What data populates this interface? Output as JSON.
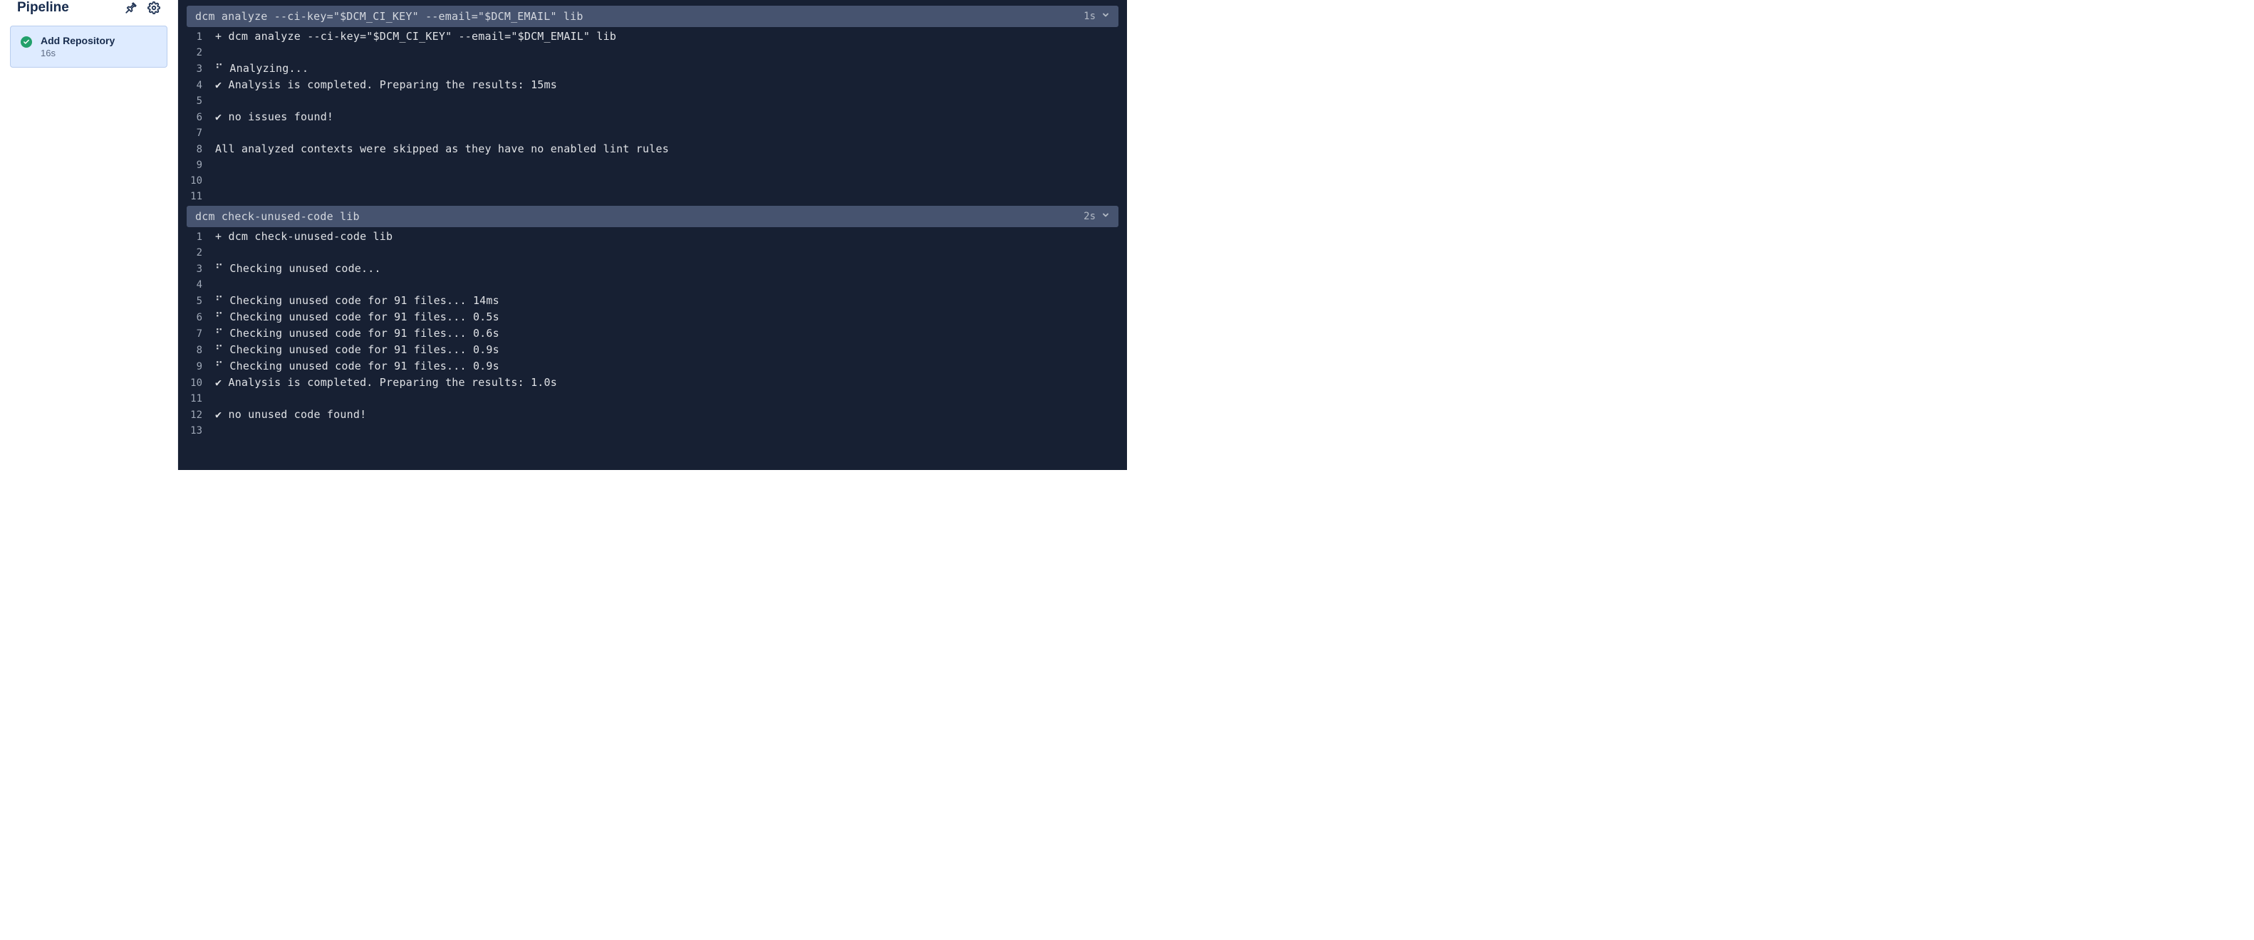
{
  "sidebar": {
    "title": "Pipeline",
    "step": {
      "name": "Add Repository",
      "duration": "16s"
    }
  },
  "console": {
    "blocks": [
      {
        "command": "dcm analyze --ci-key=\"$DCM_CI_KEY\" --email=\"$DCM_EMAIL\" lib",
        "duration": "1s",
        "lines": [
          "+ dcm analyze --ci-key=\"$DCM_CI_KEY\" --email=\"$DCM_EMAIL\" lib",
          "",
          "⠋ Analyzing...",
          "✔ Analysis is completed. Preparing the results: 15ms",
          "",
          "✔ no issues found!",
          "",
          "All analyzed contexts were skipped as they have no enabled lint rules",
          "",
          "",
          ""
        ]
      },
      {
        "command": "dcm check-unused-code lib",
        "duration": "2s",
        "lines": [
          "+ dcm check-unused-code lib",
          "",
          "⠋ Checking unused code...",
          "",
          "⠋ Checking unused code for 91 files... 14ms",
          "⠋ Checking unused code for 91 files... 0.5s",
          "⠋ Checking unused code for 91 files... 0.6s",
          "⠋ Checking unused code for 91 files... 0.9s",
          "⠋ Checking unused code for 91 files... 0.9s",
          "✔ Analysis is completed. Preparing the results: 1.0s",
          "",
          "✔ no unused code found!",
          ""
        ]
      }
    ]
  }
}
